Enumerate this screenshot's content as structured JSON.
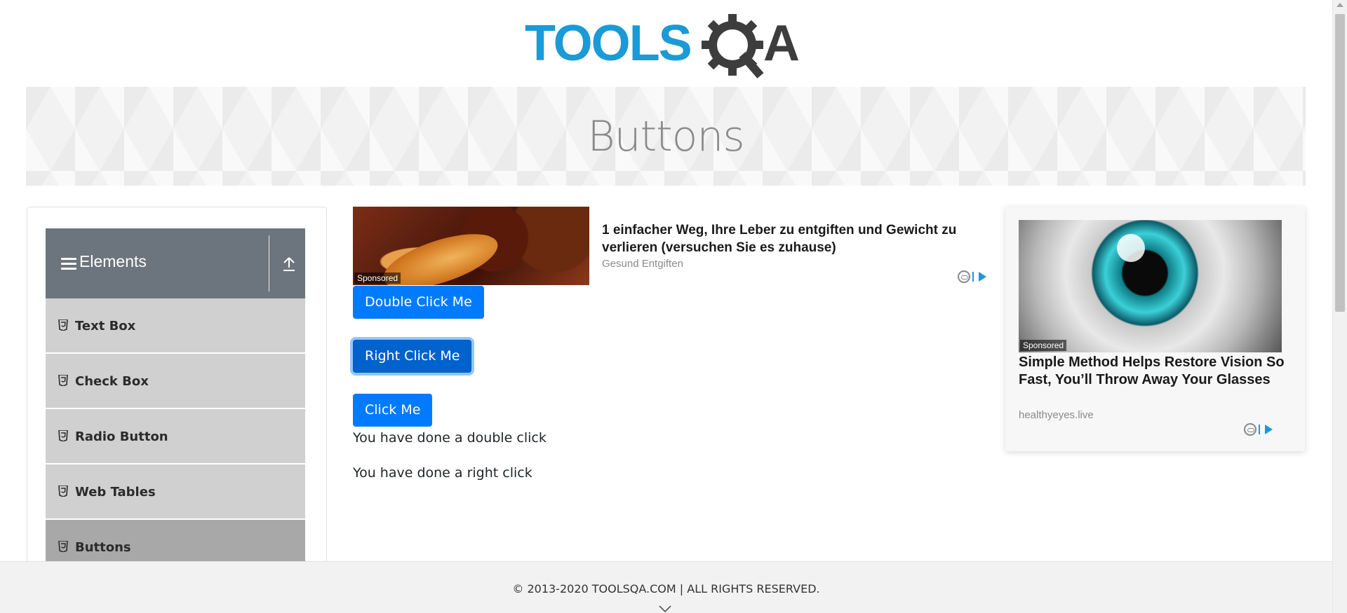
{
  "brand": {
    "logo_text": "TOOLSQA"
  },
  "banner": {
    "title": "Buttons"
  },
  "sidebar": {
    "group_title": "Elements",
    "items": [
      {
        "label": "Text Box"
      },
      {
        "label": "Check Box"
      },
      {
        "label": "Radio Button"
      },
      {
        "label": "Web Tables"
      },
      {
        "label": "Buttons"
      }
    ]
  },
  "ad_top": {
    "sponsored": "Sponsored",
    "headline": "1 einfacher Weg, Ihre Leber zu entgiften und Gewicht zu verlieren (versuchen Sie es zuhause)",
    "source": "Gesund Entgiften"
  },
  "buttons": {
    "double_click": "Double Click Me",
    "right_click": "Right Click Me",
    "click": "Click Me"
  },
  "messages": {
    "double_click": "You have done a double click",
    "right_click": "You have done a right click"
  },
  "ad_side": {
    "sponsored": "Sponsored",
    "headline": "Simple Method Helps Restore Vision So Fast, You’ll Throw Away Your Glasses",
    "source": "healthyeyes.live"
  },
  "footer": {
    "text": "© 2013-2020 TOOLSQA.COM | ALL RIGHTS RESERVED."
  },
  "colors": {
    "primary": "#007bff",
    "sidebar_header": "#6c757d",
    "logo_blue": "#1a9ad6",
    "logo_gray": "#3d3d3d"
  }
}
